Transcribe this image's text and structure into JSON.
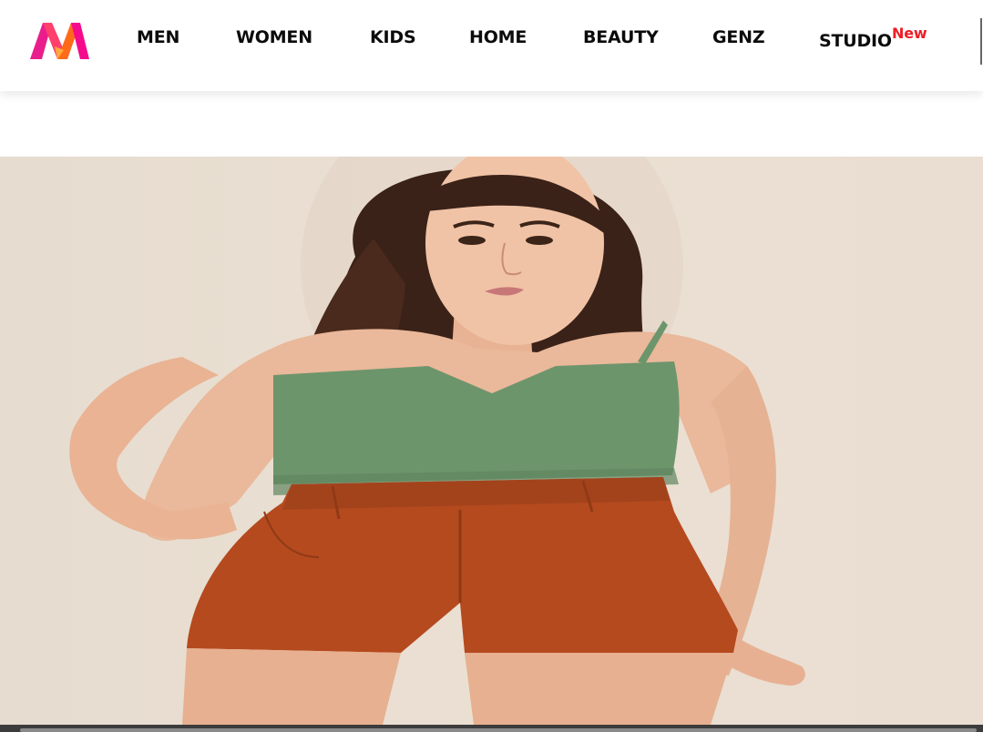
{
  "brand": {
    "logo_icon": "myntra-logo-icon"
  },
  "nav": {
    "items": [
      {
        "label": "MEN"
      },
      {
        "label": "WOMEN"
      },
      {
        "label": "KIDS"
      },
      {
        "label": "HOME"
      },
      {
        "label": "BEAUTY"
      },
      {
        "label": "GENZ"
      },
      {
        "label": "STUDIO",
        "badge": "New"
      }
    ]
  },
  "hero": {
    "image_icon": "model-photo-icon"
  },
  "colors": {
    "badge_new": "#ee1c25",
    "logo_orange": "#ff6a1a",
    "logo_pink": "#ff3f6c",
    "logo_magenta": "#e91e8c"
  }
}
